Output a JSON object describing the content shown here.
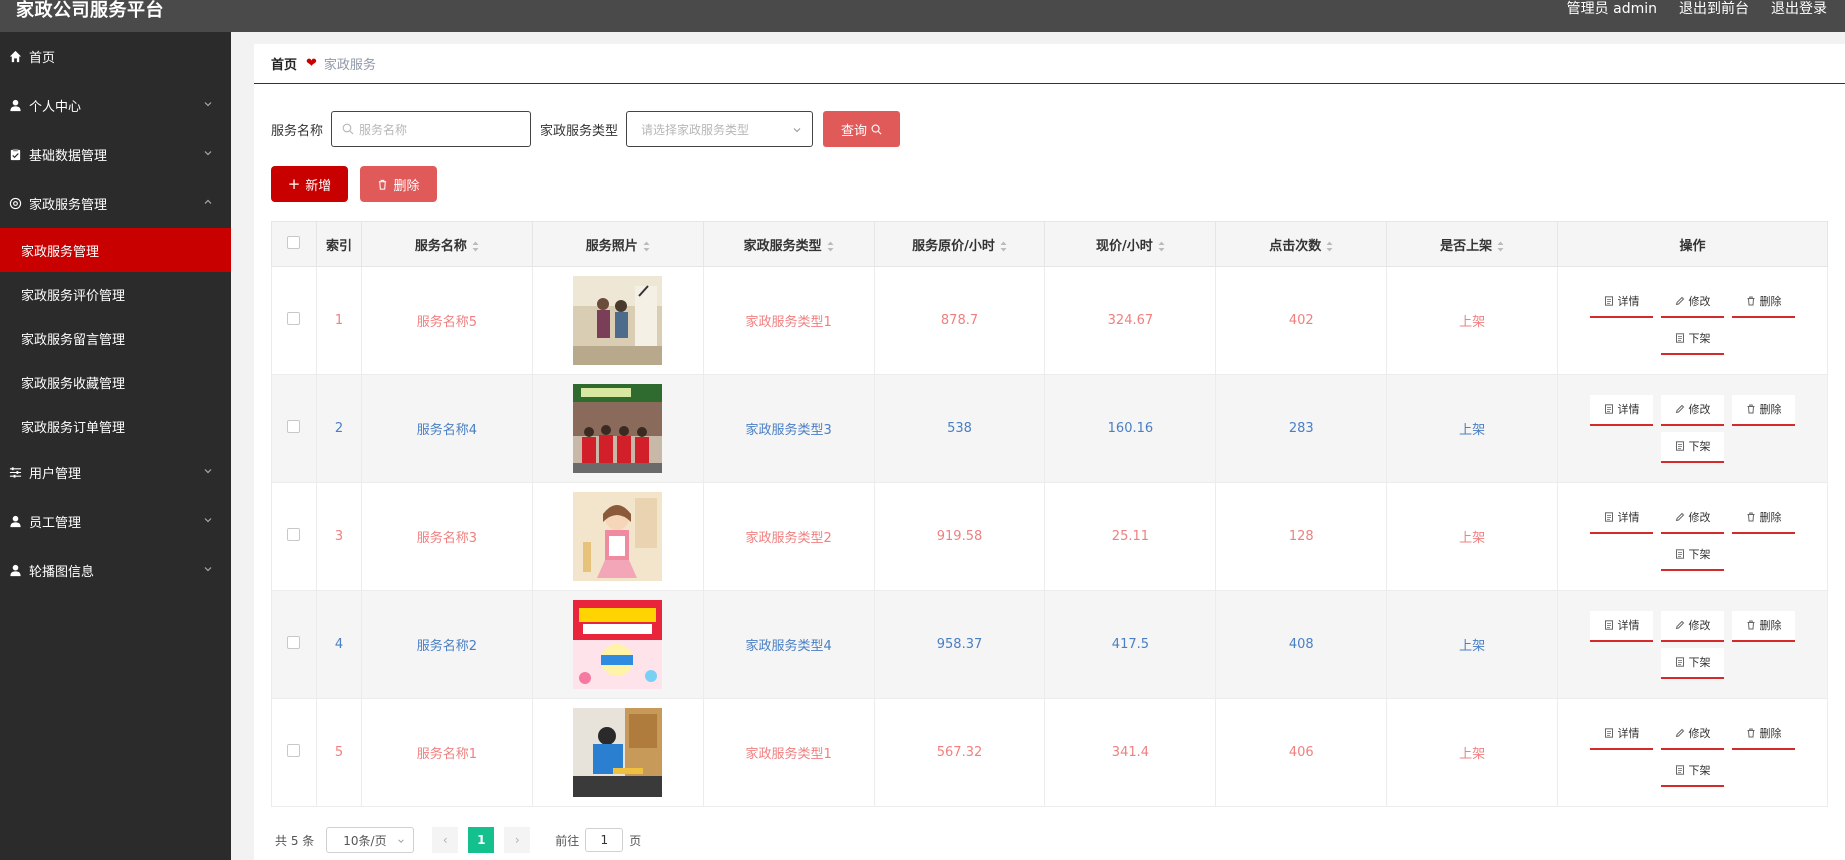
{
  "header": {
    "title": "家政公司服务平台",
    "links": [
      "管理员 admin",
      "退出到前台",
      "退出登录"
    ]
  },
  "sidebar": {
    "items": [
      {
        "label": "首页",
        "icon": "home-icon"
      },
      {
        "label": "个人中心",
        "icon": "user-icon",
        "expandable": true
      },
      {
        "label": "基础数据管理",
        "icon": "clipboard-icon",
        "expandable": true
      },
      {
        "label": "家政服务管理",
        "icon": "target-icon",
        "expandable": true,
        "expanded": true
      },
      {
        "label": "用户管理",
        "icon": "sliders-icon",
        "expandable": true
      },
      {
        "label": "员工管理",
        "icon": "user-icon",
        "expandable": true
      },
      {
        "label": "轮播图信息",
        "icon": "user-icon",
        "expandable": true
      }
    ],
    "subitems": [
      "家政服务管理",
      "家政服务评价管理",
      "家政服务留言管理",
      "家政服务收藏管理",
      "家政服务订单管理"
    ],
    "active_subitem": "家政服务管理"
  },
  "breadcrumb": {
    "home": "首页",
    "current": "家政服务"
  },
  "search": {
    "name_label": "服务名称",
    "name_placeholder": "服务名称",
    "type_label": "家政服务类型",
    "type_placeholder": "请选择家政服务类型",
    "query_label": "查询"
  },
  "toolbar": {
    "add_label": "新增",
    "delete_label": "删除"
  },
  "table": {
    "columns": [
      "索引",
      "服务名称",
      "服务照片",
      "家政服务类型",
      "服务原价/小时",
      "现价/小时",
      "点击次数",
      "是否上架",
      "操作"
    ],
    "rows": [
      {
        "index": "1",
        "name": "服务名称5",
        "photo": "cleaning-team-photo",
        "type": "家政服务类型1",
        "original_price": "878.7",
        "price": "324.67",
        "clicks": "402",
        "status": "上架"
      },
      {
        "index": "2",
        "name": "服务名称4",
        "photo": "staff-group-photo",
        "type": "家政服务类型3",
        "original_price": "538",
        "price": "160.16",
        "clicks": "283",
        "status": "上架"
      },
      {
        "index": "3",
        "name": "服务名称3",
        "photo": "cartoon-housekeeper-photo",
        "type": "家政服务类型2",
        "original_price": "919.58",
        "price": "25.11",
        "clicks": "128",
        "status": "上架"
      },
      {
        "index": "4",
        "name": "服务名称2",
        "photo": "promo-poster-photo",
        "type": "家政服务类型4",
        "original_price": "958.37",
        "price": "417.5",
        "clicks": "408",
        "status": "上架"
      },
      {
        "index": "5",
        "name": "服务名称1",
        "photo": "worker-cleaning-photo",
        "type": "家政服务类型1",
        "original_price": "567.32",
        "price": "341.4",
        "clicks": "406",
        "status": "上架"
      }
    ],
    "row_actions": {
      "detail": "详情",
      "edit": "修改",
      "delete": "删除",
      "offline": "下架"
    }
  },
  "pager": {
    "total": "共 5 条",
    "page_size": "10条/页",
    "current_page": "1",
    "goto_label": "前往",
    "goto_value": "1",
    "page_suffix": "页"
  },
  "colors": {
    "accent": "#c80000",
    "odd_text": "#f08080",
    "even_text": "#4a7fc4",
    "pager_active": "#13c08e"
  }
}
